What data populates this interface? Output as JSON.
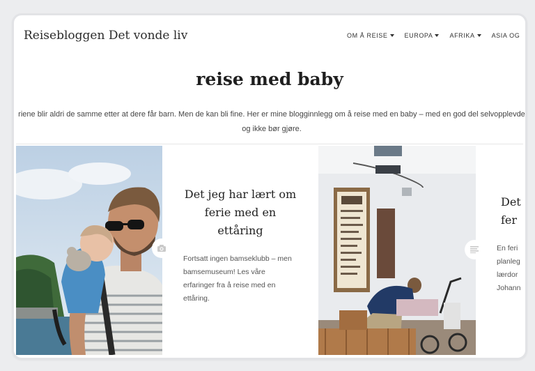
{
  "header": {
    "site_title": "Reisebloggen Det vonde liv",
    "nav": [
      {
        "label": "OM Å REISE"
      },
      {
        "label": "EUROPA"
      },
      {
        "label": "AFRIKA"
      },
      {
        "label": "ASIA OG"
      }
    ]
  },
  "page": {
    "heading": "reise med baby",
    "intro_line1": "riene blir aldri de samme etter at dere får barn. Men de kan bli fine. Her er mine blogginnlegg om å reise med en baby – med en god del selvopplevde",
    "intro_line2": "og ikke bør gjøre."
  },
  "posts": [
    {
      "title": "Det jeg har lært om ferie med en ettåring",
      "excerpt": "Fortsatt ingen bamseklubb – men bamsemuseum! Les våre erfaringer fra å reise med en ettåring.",
      "format_icon": "camera-icon"
    },
    {
      "title": "Det",
      "title_line2": "fer",
      "excerpt_lines": [
        "En feri",
        "planleg",
        "lærdor",
        "Johann"
      ],
      "format_icon": "text-lines-icon"
    }
  ],
  "colors": {
    "background": "#ecedef",
    "text": "#222222"
  }
}
